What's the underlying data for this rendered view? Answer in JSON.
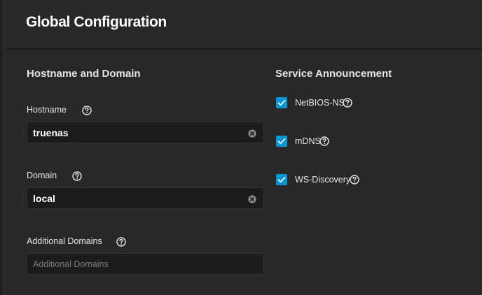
{
  "header": {
    "title": "Global Configuration"
  },
  "hostname_domain": {
    "section_title": "Hostname and Domain",
    "hostname": {
      "label": "Hostname",
      "value": "truenas"
    },
    "domain": {
      "label": "Domain",
      "value": "local"
    },
    "additional_domains": {
      "label": "Additional Domains",
      "placeholder": "Additional Domains"
    }
  },
  "service_announcement": {
    "section_title": "Service Announcement",
    "items": [
      {
        "label": "NetBIOS-NS",
        "checked": true
      },
      {
        "label": "mDNS",
        "checked": true
      },
      {
        "label": "WS-Discovery",
        "checked": true
      }
    ]
  },
  "colors": {
    "background": "#282828",
    "input_background": "#1b1b1b",
    "checkbox_accent": "#0095d5"
  },
  "icons": {
    "help": "help-circle-icon",
    "clear": "clear-circle-icon",
    "check": "check-icon"
  }
}
